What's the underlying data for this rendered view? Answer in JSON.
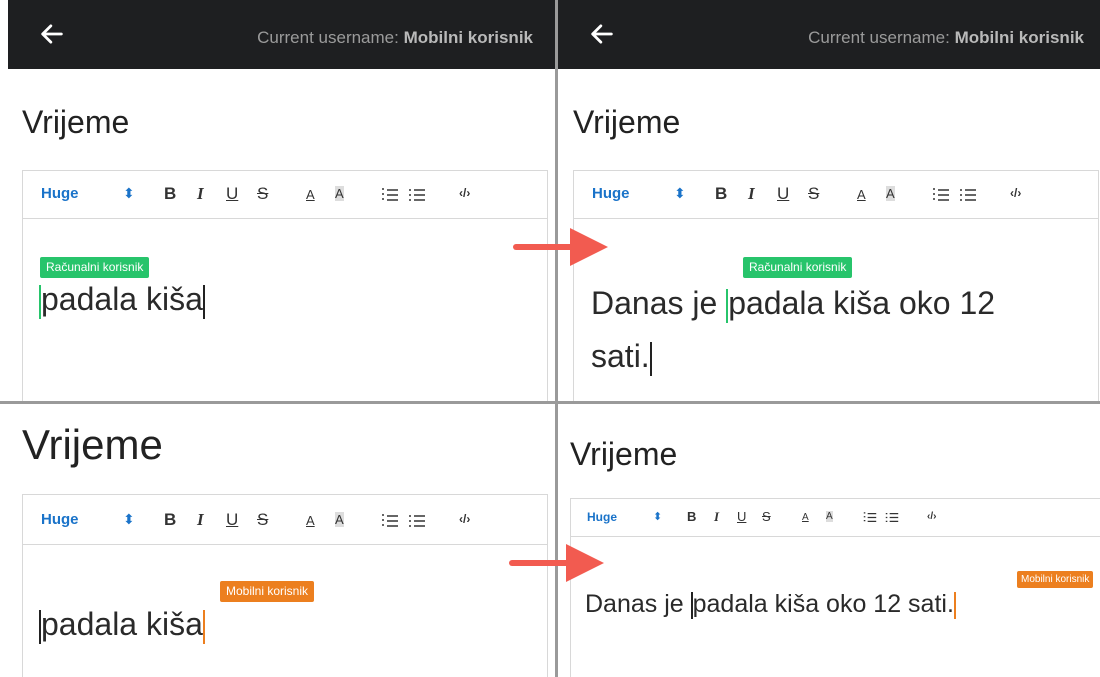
{
  "header": {
    "username_prefix": "Current username:",
    "username_value": "Mobilni korisnik"
  },
  "page": {
    "title": "Vrijeme"
  },
  "toolbar": {
    "size_label": "Huge",
    "size_arrows": "⬍",
    "bold": "B",
    "italic": "I",
    "underline": "U",
    "strike": "S",
    "text_color": "A",
    "bg_color": "A",
    "code": "‹/›"
  },
  "users": {
    "computer": "Računalni korisnik",
    "mobile": "Mobilni korisnik"
  },
  "content": {
    "before": "padala kiša",
    "prefix": "Danas je ",
    "middle": "padala kiša",
    "suffix_line1": " oko 12",
    "suffix_line2": "sati.",
    "suffix_full": " oko 12 sati."
  },
  "colors": {
    "topbar": "#1e1f21",
    "computer_user": "#27c46b",
    "mobile_user": "#ec7f1f",
    "arrow": "#f25b50",
    "accent": "#1a73c9"
  }
}
